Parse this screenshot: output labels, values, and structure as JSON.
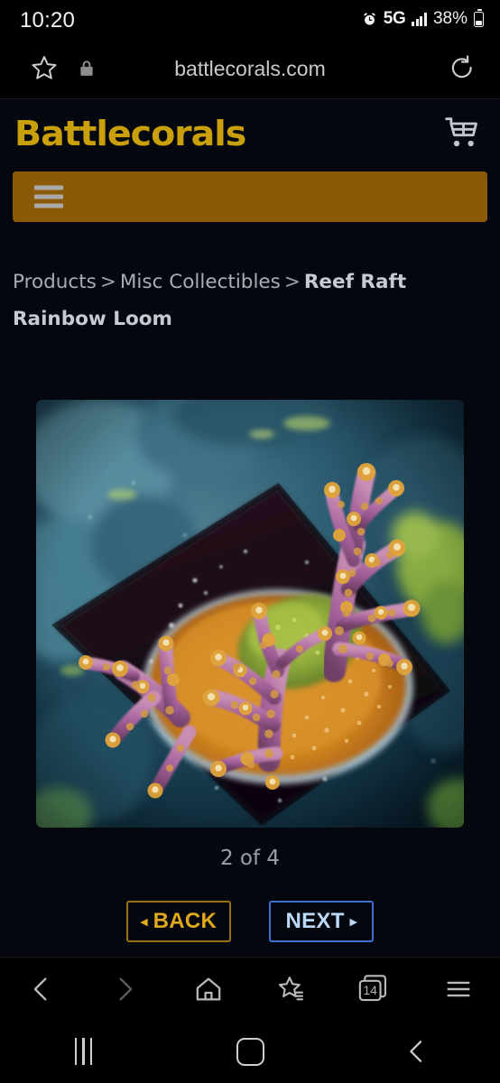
{
  "status_bar": {
    "time": "10:20",
    "network": "5G",
    "battery_percent": "38%",
    "icons": [
      "alarm-icon",
      "signal-bars-icon",
      "battery-icon"
    ]
  },
  "browser": {
    "url": "battlecorals.com",
    "url_icons": [
      "bookmark-star-icon",
      "lock-icon",
      "reload-icon"
    ],
    "toolbar": {
      "back": "back-arrow-icon",
      "forward": "forward-arrow-icon",
      "home": "home-icon",
      "bookmarks": "bookmarks-star-icon",
      "tabs_count": "14",
      "menu": "menu-icon"
    }
  },
  "site": {
    "logo": "Battlecorals",
    "logo_color": "#c9a00c",
    "cart_icon": "shopping-cart-icon",
    "menu_bar_color": "#8a5a08",
    "menu_icon": "hamburger-menu-icon"
  },
  "breadcrumb": {
    "items": [
      {
        "label": "Products",
        "current": false
      },
      {
        "label": "Misc Collectibles",
        "current": false
      },
      {
        "label": "Reef Raft Rainbow Loom",
        "current": true
      }
    ],
    "separator": ">"
  },
  "product": {
    "name": "Reef Raft Rainbow Loom",
    "image_alt": "Acropora coral frag with purple branches and gold polyp tips on orange encrusting base",
    "pager": "2 of 4",
    "current_index": 2,
    "total": 4
  },
  "gallery_controls": {
    "back_label": "BACK",
    "back_arrow": "◂",
    "next_label": "NEXT",
    "next_arrow": "▸",
    "back_color": "#e0a81c",
    "next_color": "#bcd9f7"
  },
  "system_nav": {
    "recents": "recents-icon",
    "home": "home-button-icon",
    "back": "back-button-icon"
  }
}
